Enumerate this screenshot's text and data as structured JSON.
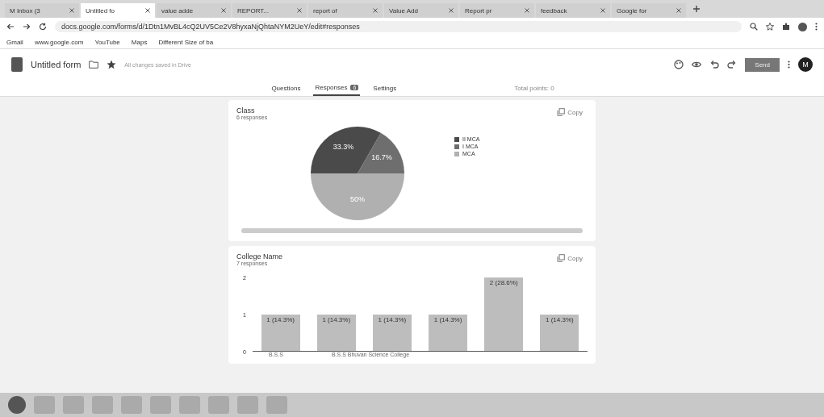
{
  "browser": {
    "tabs": [
      {
        "label": "M Inbox (3",
        "selected": false
      },
      {
        "label": "Untitled fo",
        "selected": true
      },
      {
        "label": "value adde",
        "selected": false
      },
      {
        "label": "REPORT...",
        "selected": false
      },
      {
        "label": "report of",
        "selected": false
      },
      {
        "label": "Value Add",
        "selected": false
      },
      {
        "label": "Report pr",
        "selected": false
      },
      {
        "label": "feedback",
        "selected": false
      },
      {
        "label": "Google for",
        "selected": false
      }
    ],
    "url": "docs.google.com/forms/d/1Dtn1MvBL4cQ2UV5Ce2V8hyxaNjQhtaNYM2UeY/edit#responses",
    "bookmarks": [
      "Gmail",
      "www.google.com",
      "YouTube",
      "Maps",
      "Different Size of ba"
    ]
  },
  "form": {
    "title": "Untitled form",
    "save_status": "All changes saved in Drive",
    "send": "Send",
    "avatar": "M",
    "tabs": [
      {
        "label": "Questions",
        "selected": false
      },
      {
        "label": "Responses",
        "selected": true,
        "count": "6"
      },
      {
        "label": "Settings",
        "selected": false
      }
    ],
    "points": "Total points: 0"
  },
  "cards": [
    {
      "title": "Class",
      "subtitle": "6 responses",
      "copy": "Copy",
      "chart_data": {
        "type": "pie",
        "categories": [
          "II MCA",
          "I MCA",
          "MCA"
        ],
        "series": [
          {
            "values": [
              33.3,
              16.7,
              50
            ]
          }
        ],
        "value_labels": [
          "33.3%",
          "16.7%",
          "50%"
        ],
        "legend": "right"
      }
    },
    {
      "title": "College Name",
      "subtitle": "7 responses",
      "copy": "Copy",
      "chart_data": {
        "type": "bar",
        "series": [
          {
            "values": [
              1,
              1,
              1,
              1,
              2,
              1
            ]
          }
        ],
        "ylim": [
          0,
          2
        ],
        "yticks": [
          0,
          1,
          2
        ],
        "value_labels": [
          "1 (14.3%)",
          "1 (14.3%)",
          "1 (14.3%)",
          "1 (14.3%)",
          "2 (28.6%)",
          "1 (14.3%)"
        ]
      },
      "axis_labels": [
        "B.S.S",
        "B.S.S Bhuvan Science College"
      ]
    }
  ]
}
